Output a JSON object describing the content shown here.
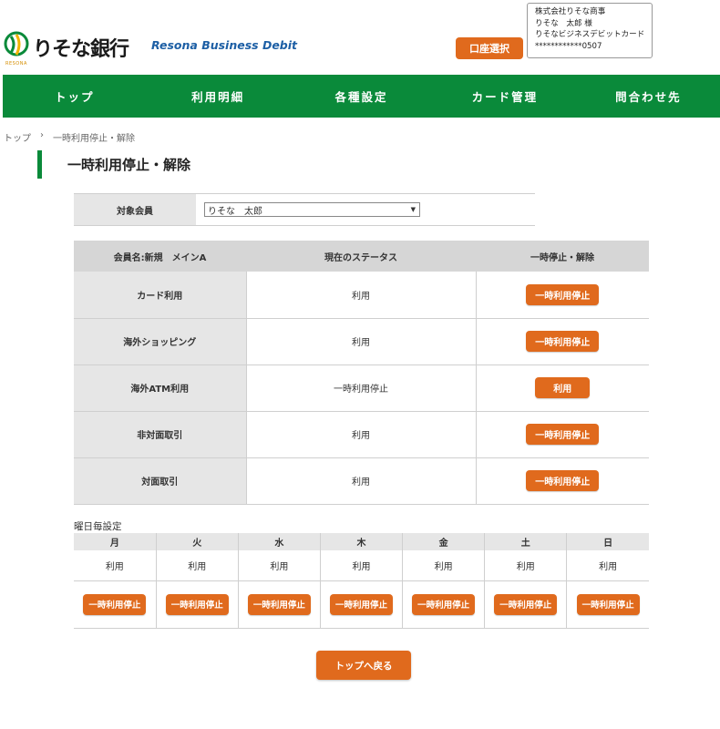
{
  "header": {
    "logo_text": "りそな銀行",
    "logo_sub": "RESONA",
    "brand": "Resona Business Debit",
    "account_button": "口座選択",
    "info": {
      "company": "株式会社りそな商事",
      "user": "りそな　太郎 様",
      "card_name": "りそなビジネスデビットカード",
      "card_number": "************0507"
    }
  },
  "nav": {
    "items": [
      "トップ",
      "利用明細",
      "各種設定",
      "カード管理",
      "問合わせ先"
    ]
  },
  "breadcrumb": {
    "home": "トップ",
    "separator": "›",
    "current": "一時利用停止・解除"
  },
  "page_title": "一時利用停止・解除",
  "member": {
    "label": "対象会員",
    "selected": "りそな　太郎"
  },
  "status_table": {
    "headers": [
      "会員名:新規　メインA",
      "現在のステータス",
      "一時停止・解除"
    ],
    "rows": [
      {
        "label": "カード利用",
        "status": "利用",
        "action": "一時利用停止"
      },
      {
        "label": "海外ショッピング",
        "status": "利用",
        "action": "一時利用停止"
      },
      {
        "label": "海外ATM利用",
        "status": "一時利用停止",
        "action": "利用"
      },
      {
        "label": "非対面取引",
        "status": "利用",
        "action": "一時利用停止"
      },
      {
        "label": "対面取引",
        "status": "利用",
        "action": "一時利用停止"
      }
    ]
  },
  "weekly": {
    "title": "曜日毎設定",
    "days": [
      "月",
      "火",
      "水",
      "木",
      "金",
      "土",
      "日"
    ],
    "statuses": [
      "利用",
      "利用",
      "利用",
      "利用",
      "利用",
      "利用",
      "利用"
    ],
    "actions": [
      "一時利用停止",
      "一時利用停止",
      "一時利用停止",
      "一時利用停止",
      "一時利用停止",
      "一時利用停止",
      "一時利用停止"
    ]
  },
  "back_button": "トップへ戻る",
  "colors": {
    "brand_green": "#0a8a3a",
    "accent_orange": "#e06a1d",
    "brand_blue": "#1d5fa5"
  }
}
